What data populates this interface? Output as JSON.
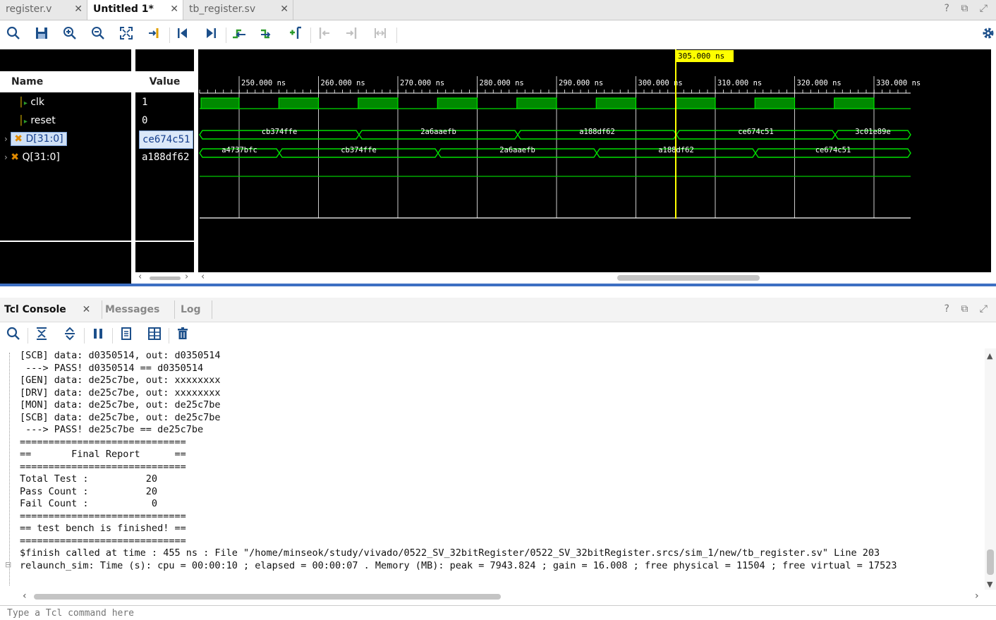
{
  "tabs": [
    {
      "label": "register.v",
      "active": false
    },
    {
      "label": "Untitled 1*",
      "active": true
    },
    {
      "label": "tb_register.sv",
      "active": false
    }
  ],
  "window_icons": "? ⧉ ⤢",
  "toolbar": {
    "icons": [
      "search-icon",
      "save-icon",
      "zoom-in-icon",
      "zoom-out-icon",
      "zoom-fit-icon",
      "go-to-cursor-icon",
      "go-to-start-icon",
      "go-to-end-icon",
      "previous-transition-icon",
      "next-transition-icon",
      "add-marker-icon",
      "previous-marker-icon",
      "next-marker-icon",
      "swap-cursors-icon",
      "settings-icon"
    ]
  },
  "wave": {
    "headers": {
      "name": "Name",
      "value": "Value"
    },
    "cursor_label": "305.000 ns",
    "time_ticks": [
      "250.000 ns",
      "260.000 ns",
      "270.000 ns",
      "280.000 ns",
      "290.000 ns",
      "300.000 ns",
      "310.000 ns",
      "320.000 ns",
      "330.000 ns"
    ],
    "signals": [
      {
        "name": "clk",
        "value": "1",
        "type": "bit",
        "expandable": false,
        "selected": false
      },
      {
        "name": "reset",
        "value": "0",
        "type": "bit",
        "expandable": false,
        "selected": false
      },
      {
        "name": "D[31:0]",
        "value": "ce674c51",
        "type": "bus",
        "expandable": true,
        "selected": true
      },
      {
        "name": "Q[31:0]",
        "value": "a188df62",
        "type": "bus",
        "expandable": true,
        "selected": false
      }
    ],
    "d_bus_values": [
      "cb374ffe",
      "2a6aaefb",
      "a188df62",
      "ce674c51",
      "3c01e89e"
    ],
    "q_bus_values": [
      "a4737bfc",
      "cb374ffe",
      "2a6aaefb",
      "a188df62",
      "ce674c51"
    ],
    "colors": {
      "wave": "#00e000",
      "cursor": "#ffff00",
      "background": "#000000"
    }
  },
  "console": {
    "tabs": [
      {
        "label": "Tcl Console",
        "active": true
      },
      {
        "label": "Messages",
        "active": false
      },
      {
        "label": "Log",
        "active": false
      }
    ],
    "lines": [
      "[SCB] data: d0350514, out: d0350514",
      " ---> PASS! d0350514 == d0350514",
      "[GEN] data: de25c7be, out: xxxxxxxx",
      "[DRV] data: de25c7be, out: xxxxxxxx",
      "[MON] data: de25c7be, out: de25c7be",
      "[SCB] data: de25c7be, out: de25c7be",
      " ---> PASS! de25c7be == de25c7be",
      "=============================",
      "==       Final Report      ==",
      "=============================",
      "Total Test :          20",
      "Pass Count :          20",
      "Fail Count :           0",
      "=============================",
      "== test bench is finished! ==",
      "=============================",
      "$finish called at time : 455 ns : File \"/home/minseok/study/vivado/0522_SV_32bitRegister/0522_SV_32bitRegister.srcs/sim_1/new/tb_register.sv\" Line 203",
      "relaunch_sim: Time (s): cpu = 00:00:10 ; elapsed = 00:00:07 . Memory (MB): peak = 7943.824 ; gain = 16.008 ; free physical = 11504 ; free virtual = 17523"
    ],
    "command_placeholder": "Type a Tcl command here"
  }
}
